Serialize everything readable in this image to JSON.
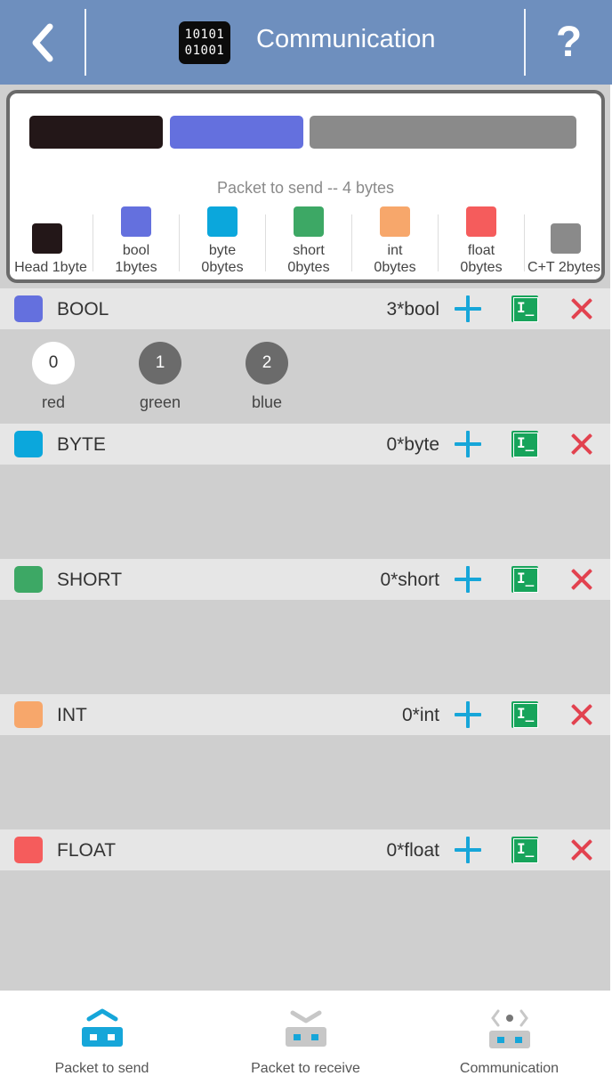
{
  "header": {
    "title": "Communication",
    "app_icon_text": [
      "10101",
      "01001"
    ],
    "help_label": "?",
    "back_icon": "chevron-left-icon",
    "bg_color": "#6e8fbe"
  },
  "packet": {
    "caption": "Packet to send -- 4 bytes",
    "bars": [
      {
        "name": "head",
        "color": "#231718"
      },
      {
        "name": "bool",
        "color": "#6470de"
      },
      {
        "name": "checksum-tail",
        "color": "#8a8a8a"
      }
    ],
    "legend": [
      {
        "name": "Head",
        "size": "1byte",
        "label": "Head 1byte",
        "color": "#231718"
      },
      {
        "name": "bool",
        "size": "1bytes",
        "color": "#6470de"
      },
      {
        "name": "byte",
        "size": "0bytes",
        "color": "#0ba7dc"
      },
      {
        "name": "short",
        "size": "0bytes",
        "color": "#3da865"
      },
      {
        "name": "int",
        "size": "0bytes",
        "color": "#f7a76b"
      },
      {
        "name": "float",
        "size": "0bytes",
        "color": "#f55c5c"
      },
      {
        "name": "C+T",
        "size": "2bytes",
        "label": "C+T 2bytes",
        "color": "#8a8a8a"
      }
    ]
  },
  "sections": [
    {
      "key": "bool",
      "name": "BOOL",
      "count": "3*bool",
      "color": "#6470de",
      "items": [
        {
          "value": "0",
          "label": "red",
          "state": "on"
        },
        {
          "value": "1",
          "label": "green",
          "state": "off"
        },
        {
          "value": "2",
          "label": "blue",
          "state": "off"
        }
      ]
    },
    {
      "key": "byte",
      "name": "BYTE",
      "count": "0*byte",
      "color": "#0ba7dc",
      "items": []
    },
    {
      "key": "short",
      "name": "SHORT",
      "count": "0*short",
      "color": "#3da865",
      "items": []
    },
    {
      "key": "int",
      "name": "INT",
      "count": "0*int",
      "color": "#f7a76b",
      "items": []
    },
    {
      "key": "float",
      "name": "FLOAT",
      "count": "0*float",
      "color": "#f55c5c",
      "items": []
    }
  ],
  "section_actions": {
    "add_icon": "plus-icon",
    "edit_icon": "text-edit-icon",
    "edit_glyph": "I_",
    "delete_icon": "close-icon"
  },
  "bottom_nav": [
    {
      "label": "Packet to send",
      "icon": "send-packet-icon",
      "active": true
    },
    {
      "label": "Packet to receive",
      "icon": "receive-packet-icon",
      "active": false
    },
    {
      "label": "Communication",
      "icon": "communication-icon",
      "active": false
    }
  ],
  "colors": {
    "accent": "#16a6d9",
    "edit": "#17a45b",
    "delete": "#e2424f"
  }
}
